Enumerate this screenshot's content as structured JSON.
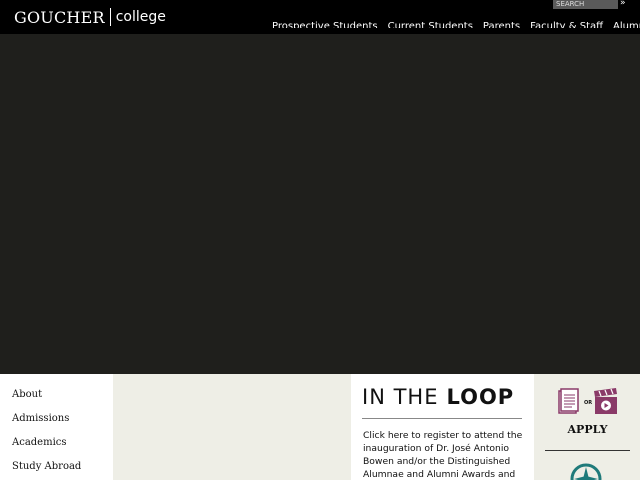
{
  "header": {
    "logo_main": "GOUCHER",
    "logo_sub": "college",
    "search_placeholder": "SEARCH",
    "search_go": "»",
    "nav": [
      "Prospective Students",
      "Current Students",
      "Parents",
      "Faculty & Staff",
      "Alumnae/i"
    ]
  },
  "sidebar": {
    "items": [
      "About",
      "Admissions",
      "Academics",
      "Study Abroad"
    ]
  },
  "loop": {
    "title_in": "IN THE",
    "title_loop": "LOOP",
    "text": "Click here to register to attend the inauguration of Dr. José Antonio Bowen and/or the Distinguished Alumnae and Alumni Awards and"
  },
  "apply": {
    "label": "APPLY",
    "or_text": "OR",
    "icon_left": "document-icon",
    "icon_right": "video-clapper-icon",
    "bottom_icon": "compass-icon"
  },
  "colors": {
    "header_bg": "#000000",
    "hero_bg": "#1f1f1c",
    "panel_bg": "#eeeee6",
    "accent_magenta": "#8a3a68",
    "accent_teal": "#1f7a7a"
  }
}
